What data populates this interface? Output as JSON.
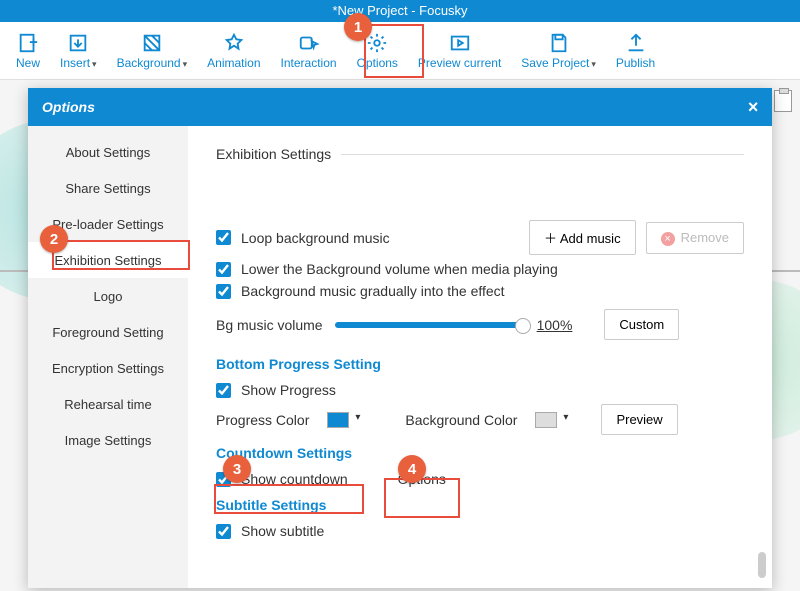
{
  "window": {
    "title": "*New Project - Focusky"
  },
  "toolbar": {
    "new": "New",
    "insert": "Insert",
    "background": "Background",
    "animation": "Animation",
    "interaction": "Interaction",
    "options": "Options",
    "preview": "Preview current",
    "save": "Save Project",
    "publish": "Publish"
  },
  "modal": {
    "title": "Options",
    "close": "×",
    "sidebar": [
      "About Settings",
      "Share Settings",
      "Pre-loader Settings",
      "Exhibition Settings",
      "Logo",
      "Foreground Setting",
      "Encryption Settings",
      "Rehearsal time",
      "Image Settings"
    ],
    "active_index": 3
  },
  "exhibition": {
    "title": "Exhibition Settings",
    "loop": "Loop background music",
    "add_music": "Add music",
    "remove": "Remove",
    "lower": "Lower the Background volume when media playing",
    "gradual": "Background music gradually into the effect",
    "bg_label": "Bg music volume",
    "bg_pct": "100%",
    "custom": "Custom",
    "bottom_head": "Bottom Progress Setting",
    "show_progress": "Show Progress",
    "progress_color": "Progress Color",
    "bg_color": "Background Color",
    "preview": "Preview",
    "countdown_head": "Countdown Settings",
    "show_countdown": "Show countdown",
    "countdown_options": "Options",
    "subtitle_head": "Subtitle Settings",
    "show_subtitle": "Show subtitle"
  },
  "badges": {
    "1": "1",
    "2": "2",
    "3": "3",
    "4": "4"
  }
}
